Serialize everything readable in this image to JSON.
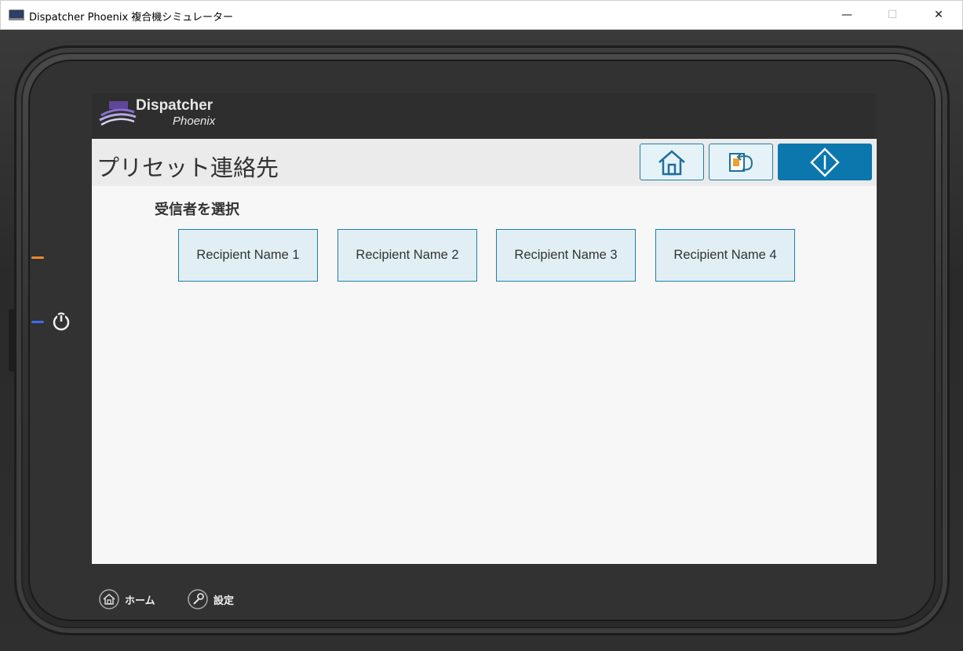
{
  "window": {
    "title": "Dispatcher Phoenix 複合機シミュレーター",
    "minimize_glyph": "—",
    "maximize_glyph": "☐",
    "close_glyph": "✕"
  },
  "brand": {
    "name_line1": "Dispatcher",
    "name_line2": "Phoenix"
  },
  "header": {
    "title": "プリセット連絡先",
    "buttons": [
      {
        "id": "home",
        "icon": "home-icon"
      },
      {
        "id": "back",
        "icon": "back-icon"
      },
      {
        "id": "start",
        "icon": "start-icon"
      }
    ]
  },
  "main": {
    "section_label": "受信者を選択",
    "recipients": [
      {
        "label": "Recipient Name 1"
      },
      {
        "label": "Recipient Name 2"
      },
      {
        "label": "Recipient Name 3"
      },
      {
        "label": "Recipient Name 4"
      }
    ]
  },
  "device_bar": {
    "home_label": "ホーム",
    "settings_label": "設定"
  },
  "colors": {
    "accent": "#0b77ad",
    "button_bg": "#e1eff5",
    "button_border": "#1f7ea6",
    "led_orange": "#e88a2e",
    "led_blue": "#3a6cf0"
  }
}
